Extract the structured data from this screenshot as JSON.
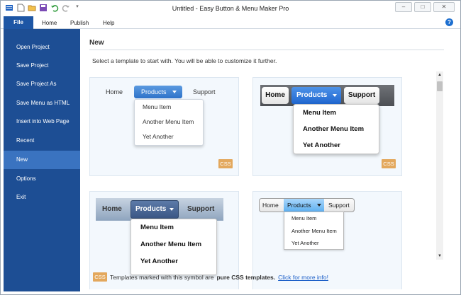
{
  "window": {
    "title": "Untitled - Easy Button & Menu Maker Pro"
  },
  "ribbon": {
    "tabs": [
      "File",
      "Home",
      "Publish",
      "Help"
    ]
  },
  "sidebar": {
    "items": [
      {
        "label": "Open Project"
      },
      {
        "label": "Save Project"
      },
      {
        "label": "Save Project As"
      },
      {
        "label": "Save Menu as HTML"
      },
      {
        "label": "Insert into Web Page"
      },
      {
        "label": "Recent"
      },
      {
        "label": "New",
        "active": true
      },
      {
        "label": "Options"
      },
      {
        "label": "Exit"
      }
    ]
  },
  "main": {
    "section_title": "New",
    "subtitle": "Select a template to start with. You will be able to customize it further.",
    "templates": [
      {
        "home": "Home",
        "products": "Products",
        "support": "Support",
        "menu": [
          "Menu Item",
          "Another Menu Item",
          "Yet Another"
        ],
        "css": true
      },
      {
        "home": "Home",
        "products": "Products",
        "support": "Support",
        "menu": [
          "Menu Item",
          "Another Menu Item",
          "Yet Another"
        ],
        "css": true
      },
      {
        "home": "Home",
        "products": "Products",
        "support": "Support",
        "menu": [
          "Menu Item",
          "Another Menu Item",
          "Yet Another"
        ]
      },
      {
        "home": "Home",
        "products": "Products",
        "support": "Support",
        "menu": [
          "Menu Item",
          "Another Menu Item",
          "Yet Another"
        ]
      }
    ],
    "css_badge": "CSS",
    "footer": {
      "badge": "CSS",
      "text_before": "Templates marked with this symbol are",
      "bold": "pure CSS templates.",
      "link": "Click for more info!"
    }
  },
  "colors": {
    "sidebar_bg": "#1d4e94",
    "sidebar_active": "#3a73c0",
    "css_badge": "#e3a85d",
    "link": "#1c5fc8"
  },
  "icons": [
    "app-menu-icon",
    "new-file-icon",
    "open-folder-icon",
    "save-icon",
    "undo-icon",
    "redo-icon",
    "customize-icon",
    "help-icon"
  ]
}
